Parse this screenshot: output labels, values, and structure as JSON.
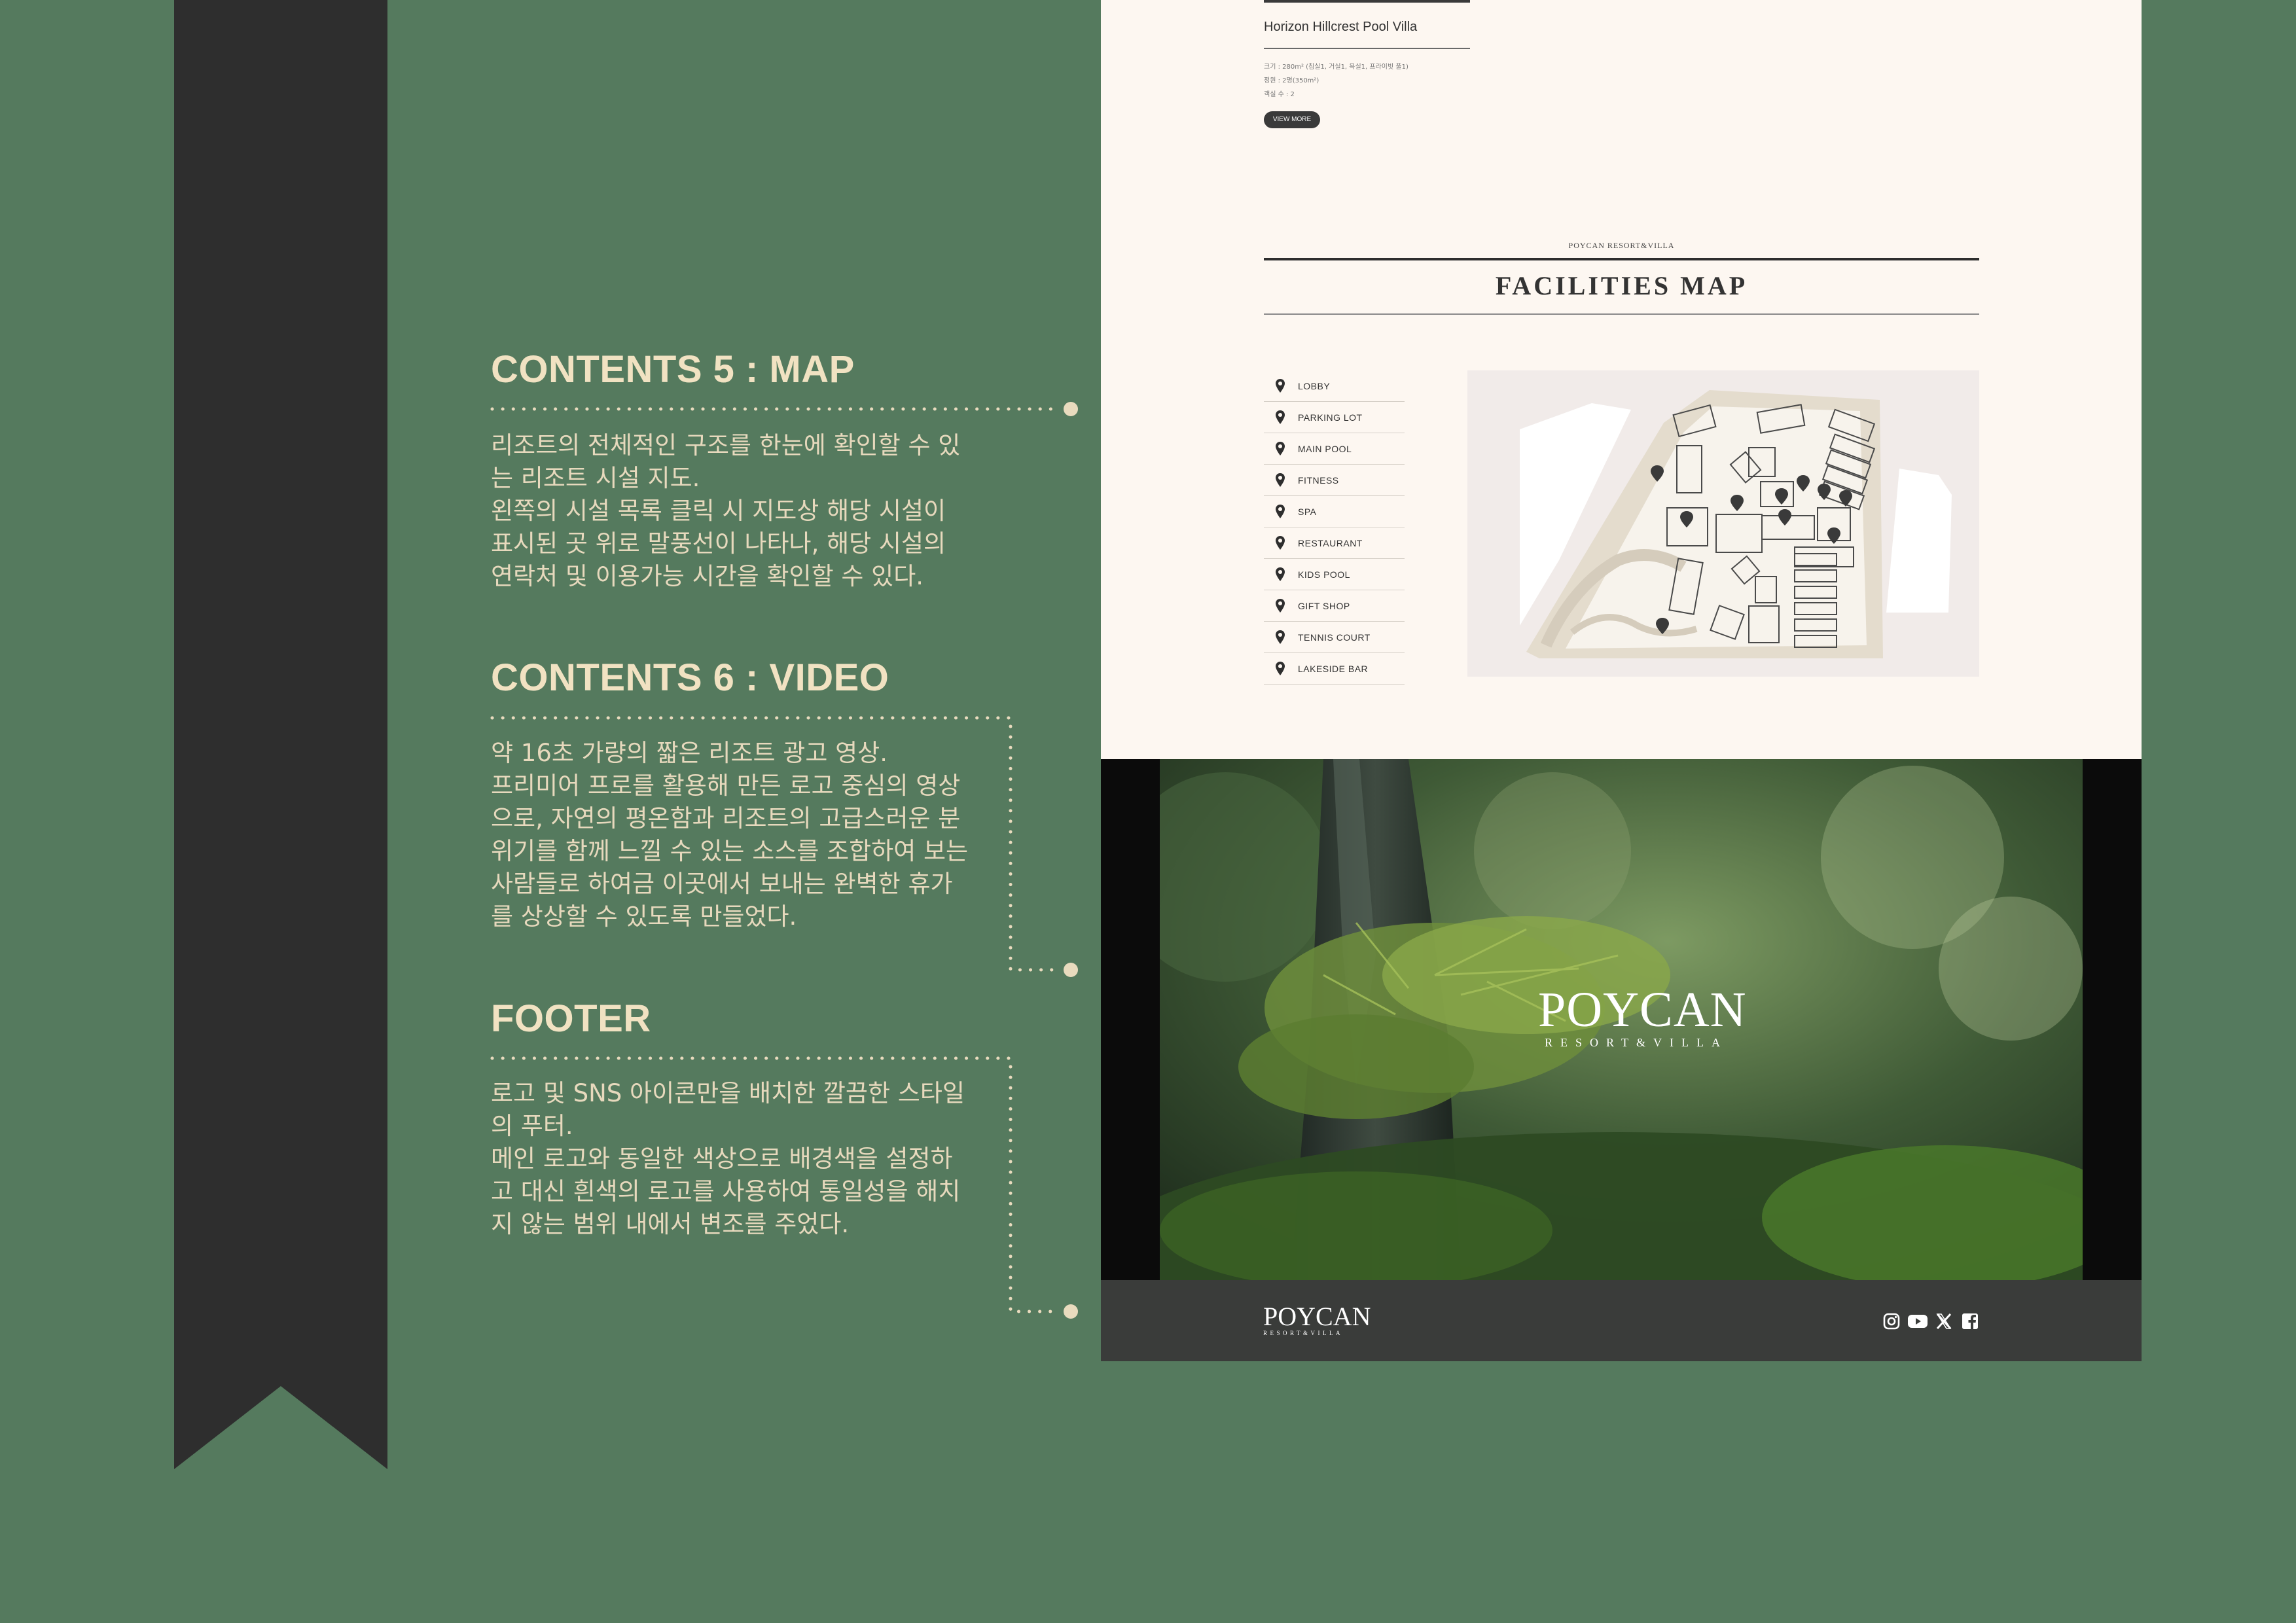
{
  "annotations": {
    "map": {
      "heading": "CONTENTS 5 : MAP",
      "lines": [
        "리조트의 전체적인 구조를 한눈에 확인할 수 있",
        "는 리조트 시설 지도.",
        "왼쪽의 시설 목록 클릭 시 지도상 해당 시설이",
        "표시된 곳 위로 말풍선이 나타나, 해당 시설의",
        "연락처 및 이용가능 시간을 확인할 수 있다."
      ]
    },
    "video": {
      "heading": "CONTENTS 6 : VIDEO",
      "lines": [
        "약 16초 가량의 짧은 리조트 광고 영상.",
        "프리미어 프로를 활용해 만든 로고 중심의 영상",
        "으로, 자연의 평온함과 리조트의 고급스러운 분",
        "위기를 함께 느낄 수 있는 소스를 조합하여 보는",
        "사람들로 하여금 이곳에서 보내는 완벽한 휴가",
        "를 상상할 수 있도록 만들었다."
      ]
    },
    "footer": {
      "heading": "FOOTER",
      "lines": [
        "로고 및 SNS 아이콘만을 배치한 깔끔한 스타일",
        "의 푸터.",
        "메인 로고와 동일한 색상으로 배경색을 설정하",
        "고 대신 흰색의 로고를 사용하여 통일성을 해치",
        "지 않는 범위 내에서 변조를 주었다."
      ]
    }
  },
  "site": {
    "villa": {
      "title": "Horizon Hillcrest Pool Villa",
      "specs": [
        "크기 : 280m² (침실1, 거실1, 욕실1, 프라이빗 풀1)",
        "정원 : 2명(350m²)",
        "객실 수 : 2"
      ],
      "button": "VIEW MORE"
    },
    "facilities": {
      "brand": "POYCAN RESORT&VILLA",
      "title": "FACILITIES MAP",
      "items": [
        "LOBBY",
        "PARKING LOT",
        "MAIN POOL",
        "FITNESS",
        "SPA",
        "RESTAURANT",
        "KIDS POOL",
        "GIFT SHOP",
        "TENNIS COURT",
        "LAKESIDE BAR"
      ]
    },
    "video": {
      "logo_word": "POYCAN",
      "logo_sub": "RESORT&VILLA"
    },
    "footer": {
      "logo_word": "POYCAN",
      "logo_sub": "RESORT&VILLA",
      "sns_icons": [
        "instagram-icon",
        "youtube-icon",
        "x-icon",
        "facebook-icon"
      ]
    }
  },
  "colors": {
    "background": "#557a5e",
    "ribbon": "#2e2e2e",
    "heading": "#f1e2c2",
    "body_text": "#e7d9bd",
    "site_bg": "#fdf7f1",
    "footer_bg": "#3a3c3a"
  }
}
